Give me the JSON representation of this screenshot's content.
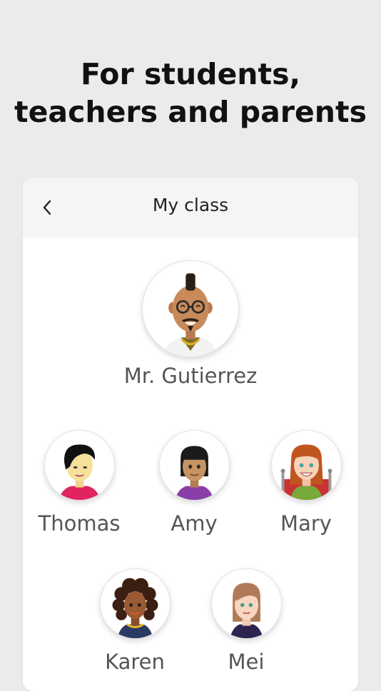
{
  "headline": {
    "line1": "For students,",
    "line2": "teachers and parents"
  },
  "nav": {
    "title": "My class",
    "back_icon": "chevron-left-icon"
  },
  "teacher": {
    "name": "Mr. Gutierrez"
  },
  "students": [
    {
      "name": "Thomas"
    },
    {
      "name": "Amy"
    },
    {
      "name": "Mary"
    },
    {
      "name": "Karen"
    },
    {
      "name": "Mei"
    }
  ]
}
